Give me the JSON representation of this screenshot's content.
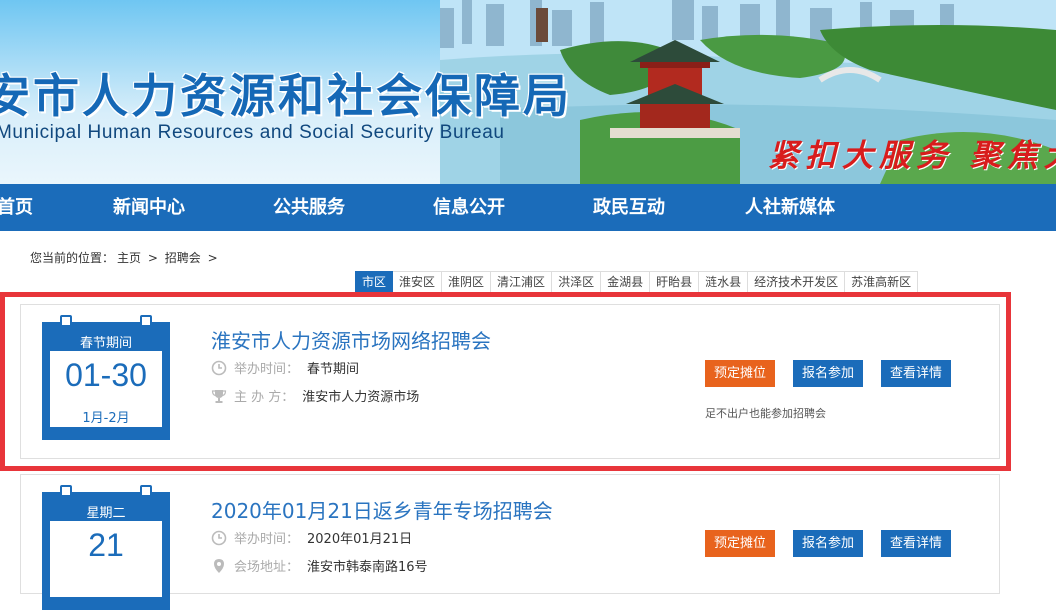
{
  "header": {
    "title_cn": "安市人力资源和社会保障局",
    "title_en": "Municipal Human Resources and Social Security Bureau",
    "slogan": "紧扣大服务   聚焦大"
  },
  "nav": [
    "首页",
    "新闻中心",
    "公共服务",
    "信息公开",
    "政民互动",
    "人社新媒体"
  ],
  "breadcrumb": {
    "prefix": "您当前的位置：",
    "home": "主页",
    "sep1": ">",
    "section": "招聘会",
    "sep2": ">"
  },
  "district_tabs": {
    "active_index": 0,
    "items": [
      "市区",
      "淮安区",
      "淮阴区",
      "清江浦区",
      "洪泽区",
      "金湖县",
      "盱眙县",
      "涟水县",
      "经济技术开发区",
      "苏淮高新区"
    ]
  },
  "events": [
    {
      "calendar_header": "春节期间",
      "calendar_date": "01-30",
      "calendar_sub": "1月-2月",
      "title": "淮安市人力资源市场网络招聘会",
      "time_label": "举办时间：",
      "time_value": "春节期间",
      "org_label": "主 办 方：",
      "org_value": "淮安市人力资源市场",
      "btn_book": "预定摊位",
      "btn_join": "报名参加",
      "btn_detail": "查看详情",
      "note": "足不出户也能参加招聘会"
    },
    {
      "calendar_header": "星期二",
      "calendar_date": "21",
      "title": "2020年01月21日返乡青年专场招聘会",
      "time_label": "举办时间：",
      "time_value": "2020年01月21日",
      "venue_label": "会场地址：",
      "venue_value": "淮安市韩泰南路16号",
      "btn_book": "预定摊位",
      "btn_join": "报名参加",
      "btn_detail": "查看详情"
    }
  ],
  "colors": {
    "primary_blue": "#1b6cba",
    "button_orange": "#e8631d",
    "highlight_red": "#e8353a",
    "slogan_red": "#d81c1c"
  }
}
